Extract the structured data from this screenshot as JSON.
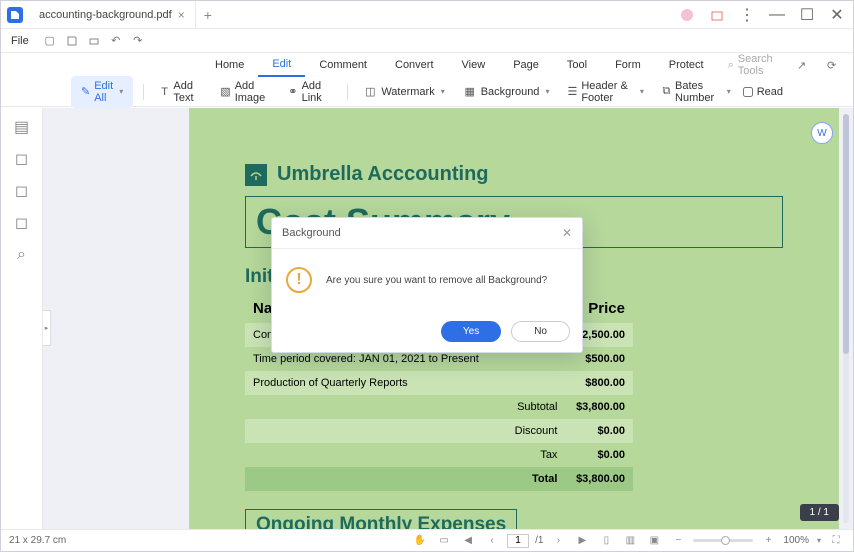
{
  "titlebar": {
    "tab_name": "accounting-background.pdf"
  },
  "menu": {
    "file": "File",
    "items": [
      "Home",
      "Edit",
      "Comment",
      "Convert",
      "View",
      "Page",
      "Tool",
      "Form",
      "Protect"
    ],
    "active": 1,
    "search_placeholder": "Search Tools"
  },
  "toolbar": {
    "edit_all": "Edit All",
    "add_text": "Add Text",
    "add_image": "Add Image",
    "add_link": "Add Link",
    "watermark": "Watermark",
    "background": "Background",
    "header_footer": "Header & Footer",
    "bates": "Bates Number",
    "read": "Read"
  },
  "doc": {
    "brand": "Umbrella Acccounting",
    "title": "Cost Summary",
    "section1": "Init",
    "col_name": "Nan",
    "col_price": "Price",
    "rows": [
      {
        "name": "Conversion from Angular Systems Inc. to A A Wellington Co.",
        "price": "$2,500.00"
      },
      {
        "name": "Time period covered: JAN 01, 2021 to Present",
        "price": "$500.00"
      },
      {
        "name": "Production of Quarterly Reports",
        "price": "$800.00"
      }
    ],
    "summary": [
      {
        "label": "Subtotal",
        "price": "$3,800.00"
      },
      {
        "label": "Discount",
        "price": "$0.00"
      },
      {
        "label": "Tax",
        "price": "$0.00"
      },
      {
        "label": "Total",
        "price": "$3,800.00"
      }
    ],
    "section2": "Ongoing Monthly Expenses"
  },
  "dialog": {
    "title": "Background",
    "message": "Are you sure you want to remove all Background?",
    "yes": "Yes",
    "no": "No"
  },
  "status": {
    "dims": "21 x 29.7 cm",
    "page_current": "1",
    "page_sep": "/1",
    "zoom": "100%",
    "page_indicator": "1 / 1"
  }
}
